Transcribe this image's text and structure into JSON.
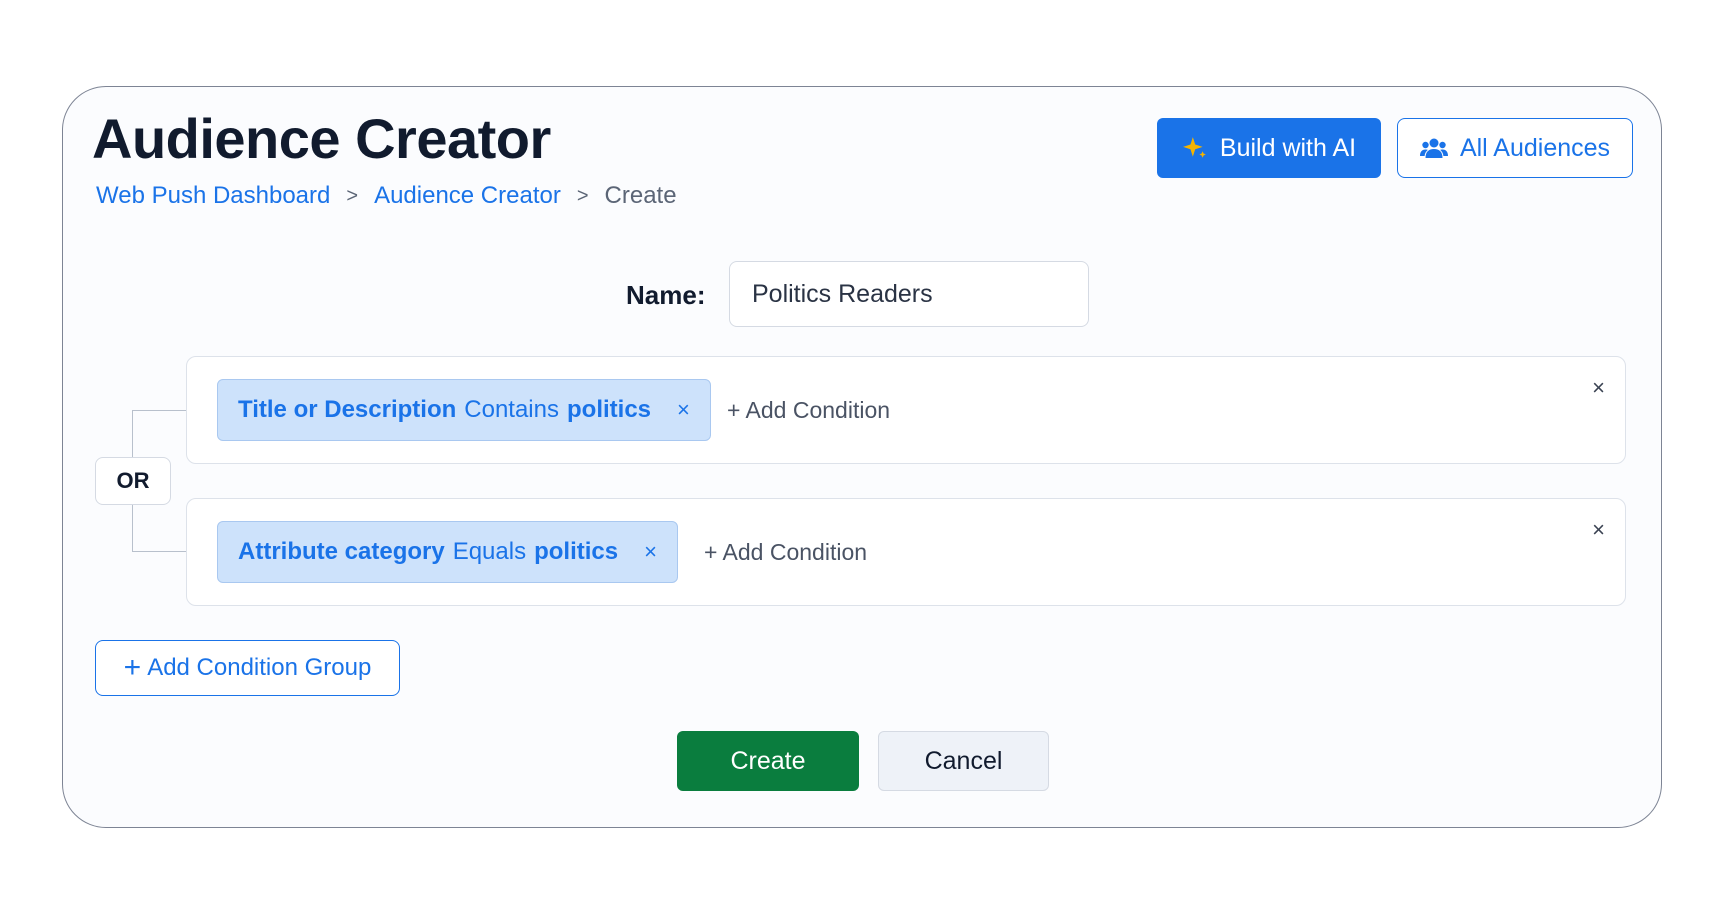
{
  "page": {
    "title": "Audience Creator",
    "breadcrumb": [
      {
        "label": "Web Push Dashboard"
      },
      {
        "label": "Audience Creator"
      },
      {
        "label": "Create"
      }
    ],
    "breadcrumb_separator": ">"
  },
  "header_actions": {
    "build_ai_label": "Build with AI",
    "build_ai_icon": "sparkle-icon",
    "all_audiences_label": "All Audiences",
    "all_audiences_icon": "users-icon"
  },
  "form": {
    "name_label": "Name:",
    "name_value": "Politics Readers",
    "logic_operator": "OR",
    "groups": [
      {
        "condition": {
          "field": "Title or Description",
          "operator": "Contains",
          "value": "politics"
        },
        "remove_condition_glyph": "×",
        "add_condition_label": "+ Add Condition",
        "remove_group_glyph": "×"
      },
      {
        "condition": {
          "field": "Attribute category",
          "operator": "Equals",
          "value": "politics"
        },
        "remove_condition_glyph": "×",
        "add_condition_label": "+ Add Condition",
        "remove_group_glyph": "×"
      }
    ],
    "add_group_label": "Add Condition Group",
    "add_group_glyph": "+",
    "create_label": "Create",
    "cancel_label": "Cancel"
  },
  "colors": {
    "accent": "#1a73e8",
    "create": "#0a7d3e",
    "chip_bg": "#cde2fb",
    "sparkle": "#f5b400"
  }
}
